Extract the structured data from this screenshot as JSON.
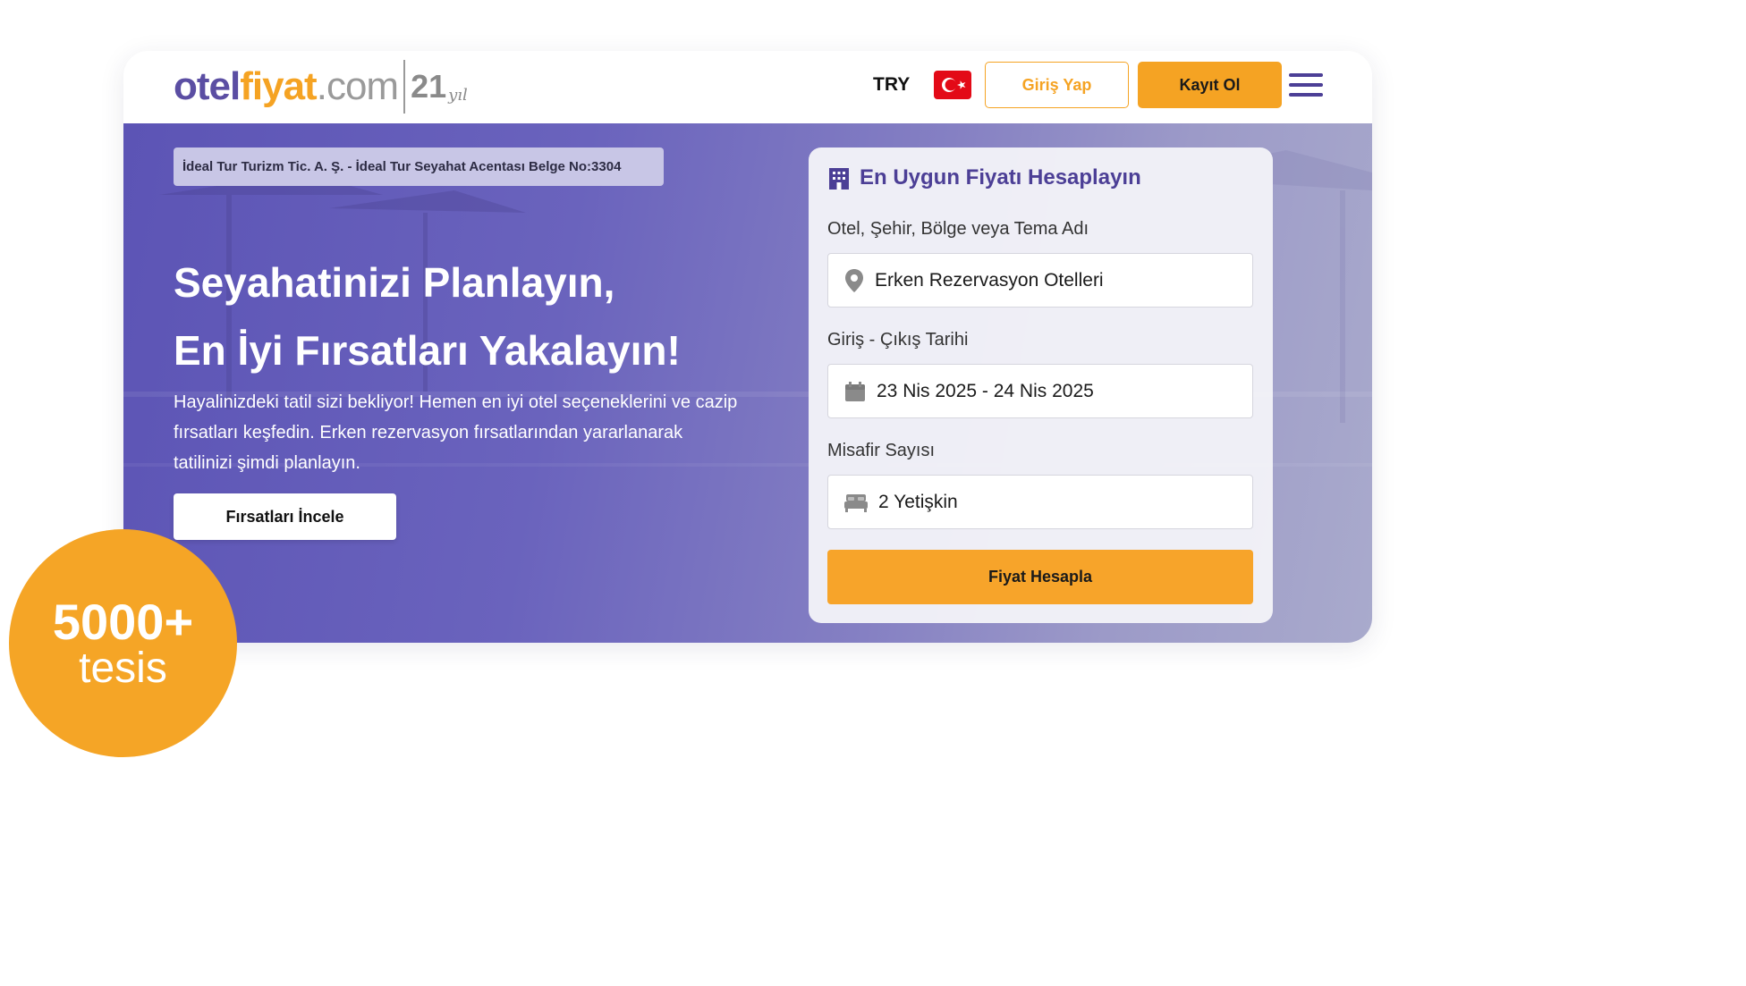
{
  "brand": {
    "otel": "otel",
    "fiyat": "fiyat",
    "com": ".com",
    "years": "21",
    "years_suffix": "yıl",
    "colors": {
      "primary": "#5b4ea3",
      "accent": "#f5a323"
    }
  },
  "nav": {
    "currency": "TRY",
    "flag_icon": "turkey-flag-icon",
    "login_label": "Giriş Yap",
    "register_label": "Kayıt Ol",
    "menu_icon": "hamburger-menu-icon"
  },
  "hero": {
    "license": "İdeal Tur Turizm Tic. A. Ş. - İdeal Tur Seyahat Acentası Belge No:3304",
    "headline_line1": "Seyahatinizi Planlayın,",
    "headline_line2": "En İyi Fırsatları Yakalayın!",
    "subtext": "Hayalinizdeki tatil sizi bekliyor! Hemen en iyi otel seçeneklerini ve cazip fırsatları keşfedin. Erken rezervasyon fırsatlarından yararlanarak tatilinizi şimdi planlayın.",
    "cta_label": "Fırsatları İncele"
  },
  "search": {
    "title": "En Uygun Fiyatı Hesaplayın",
    "title_icon": "hotel-building-icon",
    "destination_label": "Otel, Şehir, Bölge veya Tema Adı",
    "destination_value": "Erken Rezervasyon Otelleri",
    "destination_icon": "location-pin-icon",
    "dates_label": "Giriş - Çıkış Tarihi",
    "dates_value": "23 Nis 2025 - 24 Nis 2025",
    "dates_icon": "calendar-icon",
    "guests_label": "Misafir Sayısı",
    "guests_value": "2 Yetişkin",
    "guests_icon": "bed-icon",
    "submit_label": "Fiyat Hesapla"
  },
  "badge": {
    "count": "5000+",
    "label": "tesis"
  }
}
